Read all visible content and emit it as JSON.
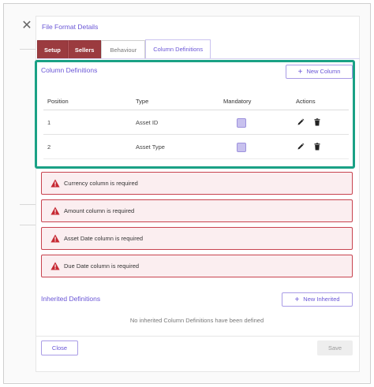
{
  "modal": {
    "title": "File Format Details",
    "close_glyph": "✕"
  },
  "tabs": [
    {
      "label": "Setup",
      "style": "dark"
    },
    {
      "label": "Sellers",
      "style": "dark"
    },
    {
      "label": "Behaviour",
      "style": "plain"
    },
    {
      "label": "Column Definitions",
      "style": "active"
    }
  ],
  "column_definitions": {
    "title": "Column Definitions",
    "new_button": "New Column",
    "headers": {
      "position": "Position",
      "type": "Type",
      "mandatory": "Mandatory",
      "actions": "Actions"
    },
    "rows": [
      {
        "position": "1",
        "type": "Asset ID",
        "mandatory": true
      },
      {
        "position": "2",
        "type": "Asset Type",
        "mandatory": true
      }
    ]
  },
  "alerts": [
    "Currency column is required",
    "Amount column is required",
    "Asset Date column is required",
    "Due Date column is required"
  ],
  "inherited": {
    "title": "Inherited Definitions",
    "new_button": "New Inherited",
    "empty_text": "No inherited Column Definitions have been defined"
  },
  "footer": {
    "close_label": "Close",
    "save_label": "Save"
  },
  "colors": {
    "accent": "#6a56d6",
    "tab_dark": "#9b3b3f",
    "highlight": "#1aa185",
    "alert_border": "#c8434f",
    "alert_bg": "#fbeef0"
  },
  "icons": [
    "close-icon",
    "plus-icon",
    "pencil-icon",
    "trash-icon",
    "warning-icon"
  ]
}
